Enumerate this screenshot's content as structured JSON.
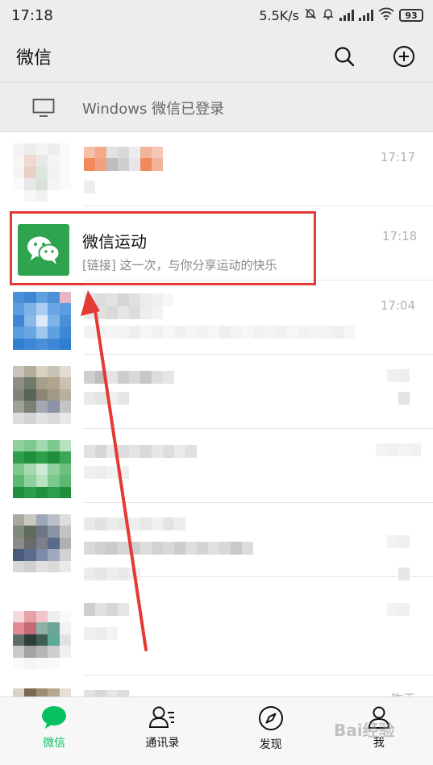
{
  "status_bar": {
    "time": "17:18",
    "net_speed": "5.5K/s",
    "battery": "93"
  },
  "header": {
    "title": "微信",
    "search_icon": "search-icon",
    "add_icon": "plus-circle-icon"
  },
  "login_notice": {
    "text": "Windows 微信已登录",
    "icon": "monitor-icon"
  },
  "chats": [
    {
      "time": "17:17"
    },
    {
      "name": "微信运动",
      "message": "[链接] 这一次，与你分享运动的快乐",
      "time": "17:18",
      "highlighted": true
    },
    {
      "time": "17:04"
    },
    {
      "time": ""
    },
    {
      "time": ""
    },
    {
      "time": ""
    },
    {
      "time": ""
    },
    {
      "time": "昨天"
    }
  ],
  "tabs": [
    {
      "label": "微信",
      "icon": "chat-bubble-icon",
      "active": true
    },
    {
      "label": "通讯录",
      "icon": "contacts-icon",
      "active": false
    },
    {
      "label": "发现",
      "icon": "compass-icon",
      "active": false
    },
    {
      "label": "我",
      "icon": "profile-icon",
      "active": false
    }
  ],
  "watermark": "Bai经验",
  "colors": {
    "accent_green": "#07c160",
    "annotation_red": "#e53935",
    "wechat_sport_bg": "#2ea44f"
  }
}
